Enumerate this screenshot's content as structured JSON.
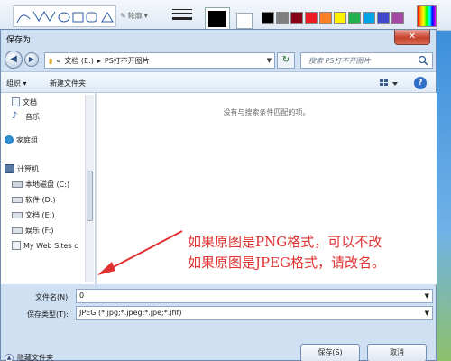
{
  "toolbar": {
    "outline_label": "轮廓",
    "palette_colors": [
      "#000000",
      "#7f7f7f",
      "#880015",
      "#ed1c24",
      "#ff7f27",
      "#fff200",
      "#22b14c",
      "#00a2e8",
      "#3f48cc",
      "#a349a4"
    ],
    "color1": "#000000",
    "color2": "#ffffff"
  },
  "dialog": {
    "title": "保存为",
    "close_label": "✕"
  },
  "address": {
    "prefix": "«",
    "path_drive": "文档 (E:)",
    "path_folder": "PS打不开图片",
    "search_placeholder": "搜索 PS打不开图片"
  },
  "commands": {
    "organize": "组织 ▾",
    "new_folder": "新建文件夹"
  },
  "navpane": {
    "items": [
      {
        "label": "文档"
      },
      {
        "label": "音乐"
      },
      {
        "label": "家庭组"
      },
      {
        "label": "计算机"
      },
      {
        "label": "本地磁盘 (C:)"
      },
      {
        "label": "软件 (D:)"
      },
      {
        "label": "文档 (E:)"
      },
      {
        "label": "娱乐 (F:)"
      },
      {
        "label": "My Web Sites c"
      }
    ]
  },
  "content": {
    "empty_message": "没有与搜索条件匹配的项。"
  },
  "form": {
    "filename_label": "文件名(N):",
    "filename_value": "0",
    "type_label": "保存类型(T):",
    "type_value": "JPEG (*.jpg;*.jpeg;*.jpe;*.jfif)",
    "hide_folders": "隐藏文件夹",
    "save_button": "保存(S)",
    "cancel_button": "取消"
  },
  "annotation": {
    "line1": "如果原图是PNG格式，可以不改",
    "line2": "如果原图是JPEG格式，请改名。",
    "color": "#e03030"
  }
}
